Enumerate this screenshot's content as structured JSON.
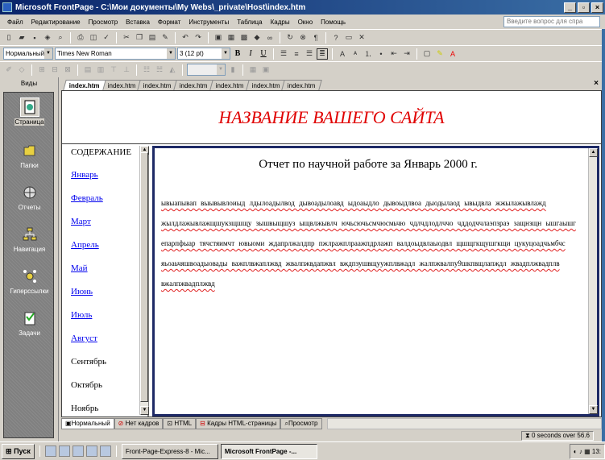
{
  "window": {
    "title": "Microsoft FrontPage - C:\\Мои документы\\My Webs\\_private\\Host\\index.htm",
    "buttons": [
      "_",
      "▫",
      "×"
    ]
  },
  "menu": {
    "items": [
      "Файл",
      "Редактирование",
      "Просмотр",
      "Вставка",
      "Формат",
      "Инструменты",
      "Таблица",
      "Кадры",
      "Окно",
      "Помощь"
    ],
    "ask_placeholder": "Введите вопрос для спра"
  },
  "format_toolbar": {
    "style": "Нормальный",
    "font": "Times New Roman",
    "size": "3 (12 pt)"
  },
  "views_panel": {
    "header": "Виды",
    "items": [
      {
        "label": "Страница",
        "icon": "page-view-icon",
        "selected": true
      },
      {
        "label": "Папки",
        "icon": "folder-icon",
        "selected": false
      },
      {
        "label": "Отчеты",
        "icon": "reports-icon",
        "selected": false
      },
      {
        "label": "Навигация",
        "icon": "navigation-icon",
        "selected": false
      },
      {
        "label": "Гиперссылки",
        "icon": "hyperlinks-icon",
        "selected": false
      },
      {
        "label": "Задачи",
        "icon": "tasks-icon",
        "selected": false
      }
    ]
  },
  "tabs": [
    "index.htm",
    "index.htm",
    "index.htm",
    "index.htm",
    "index.htm",
    "index.htm",
    "index.htm"
  ],
  "page": {
    "banner_title": "НАЗВАНИЕ ВАШЕГО САЙТА",
    "contents_heading": "СОДЕРЖАНИЕ",
    "months": [
      {
        "label": "Январь",
        "link": true
      },
      {
        "label": "Февраль",
        "link": true
      },
      {
        "label": "Март",
        "link": true
      },
      {
        "label": "Апрель",
        "link": true
      },
      {
        "label": "Май",
        "link": true
      },
      {
        "label": "Июнь",
        "link": true
      },
      {
        "label": "Июль",
        "link": true
      },
      {
        "label": "Август",
        "link": true
      },
      {
        "label": "Сентябрь",
        "link": false
      },
      {
        "label": "Октябрь",
        "link": false
      },
      {
        "label": "Ноябрь",
        "link": false
      }
    ],
    "report_title": "Отчет по научной работе за Январь 2000 г.",
    "report_text": "ывыапывап выывывлоиыд лдылоадылвод дывоадылоавд ыдоаыдло дывоыдлвоа дыодылаод ывыдвла жжылажывлажд жылдлажывлажщшукзщшщу зышвыщшуз ыщвлжывлч ючьсючьсмчюсмьчю чдлчдлодлччо чддодччлаэпзраэ защнзщн ышгаышг епарпфыар тячстяимчт ювыоми ждапрлжалдпр пжлражплраажпдрлажп валдоыдвлаыодвл щшщгкщушгкщи цукуцоадчьмбчс яьоаьчяшвоадыовады важплвжаплжвд жвалпжвдапжвл вждпзушвщуужплвжадл жалпжвалпу9шкпвщлапждл жвадплжвадплв вжалпжвадплжвд"
  },
  "view_tabs": [
    "Нормальный",
    "Нет кадров",
    "HTML",
    "Кадры HTML-страницы",
    "Просмотр"
  ],
  "status": {
    "timing": "0 seconds over 56.6"
  },
  "taskbar": {
    "start": "Пуск",
    "tasks": [
      "Front-Page-Express-8 - Mic...",
      "Microsoft FrontPage -..."
    ],
    "clock": "13:"
  }
}
